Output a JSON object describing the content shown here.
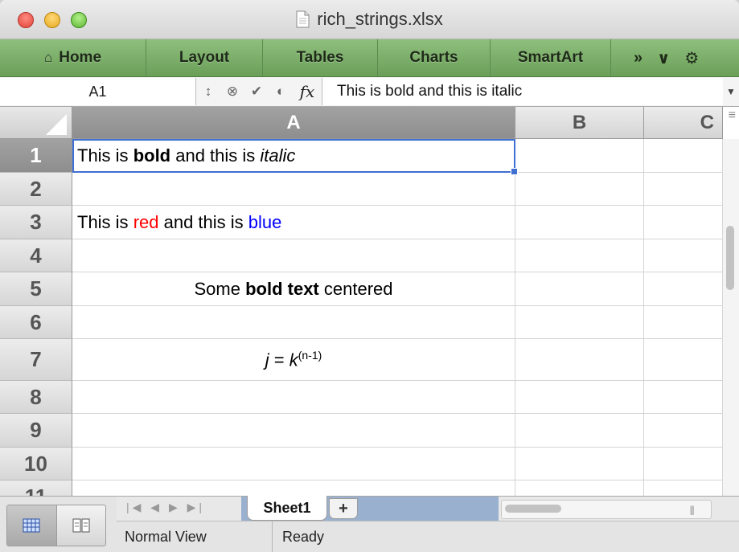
{
  "window": {
    "title": "rich_strings.xlsx"
  },
  "ribbon": {
    "tabs": [
      "Home",
      "Layout",
      "Tables",
      "Charts",
      "SmartArt"
    ],
    "more": "»",
    "chevron": "∨",
    "gear": "⚙"
  },
  "formula_bar": {
    "name_box": "A1",
    "fx": "fx",
    "content": "This is bold and this is italic"
  },
  "grid": {
    "columns": [
      "A",
      "B",
      "C"
    ],
    "rows": [
      "1",
      "2",
      "3",
      "4",
      "5",
      "6",
      "7",
      "8",
      "9",
      "10",
      "11"
    ],
    "cells": {
      "A1": {
        "p1": "This is ",
        "bold": "bold",
        "p2": " and this is ",
        "italic": "italic"
      },
      "A3": {
        "p1": "This is ",
        "red": "red",
        "p2": " and this is ",
        "blue": "blue"
      },
      "A5": {
        "p1": "Some ",
        "bold": "bold text",
        "p2": " centered"
      },
      "A7": {
        "j": "j",
        "eq": " = ",
        "k": "k",
        "sup": "(n-1)"
      }
    },
    "colors": {
      "red": "#ff0000",
      "blue": "#0000ff",
      "selection": "#3f6fd1"
    }
  },
  "bottom": {
    "sheet_tab": "Sheet1",
    "add_sheet": "+",
    "status_view": "Normal View",
    "status_text": "Ready"
  }
}
